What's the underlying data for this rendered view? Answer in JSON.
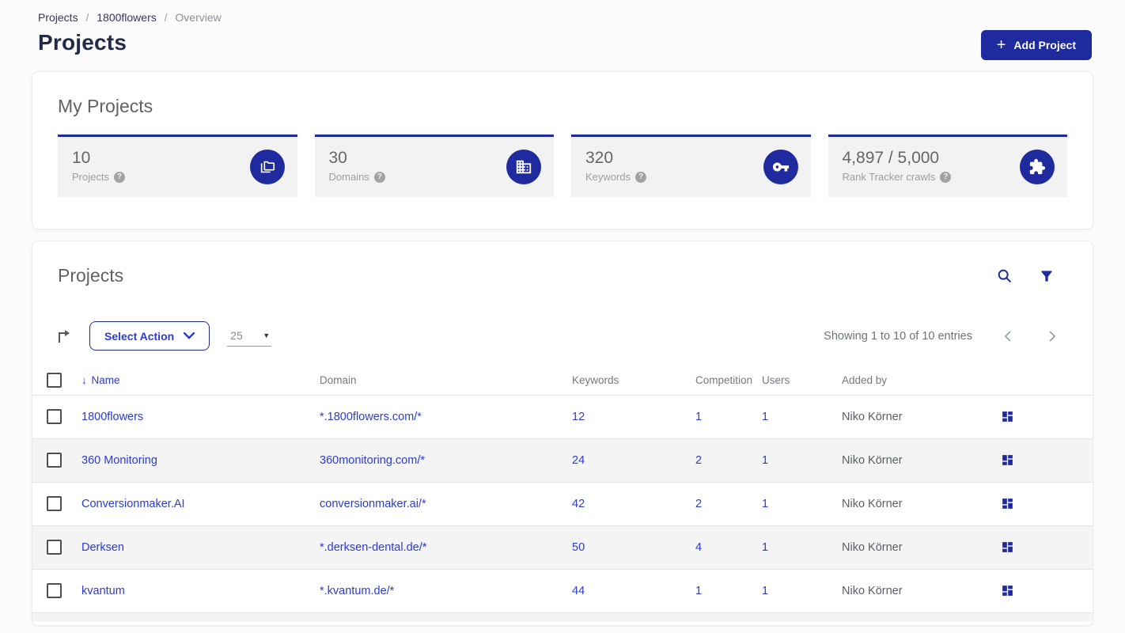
{
  "colors": {
    "brand_blue": "#1e2a9d",
    "link_blue": "#2c3bd2",
    "title_navy": "#232b46",
    "card_bg": "#f2f2f2",
    "alt_row_bg": "#f4f4f4"
  },
  "breadcrumb": {
    "separator": "/",
    "items": [
      {
        "label": "Projects"
      },
      {
        "label": "1800flowers"
      },
      {
        "label": "Overview"
      }
    ]
  },
  "header": {
    "title": "Projects",
    "add_button_label": "Add Project",
    "add_button_icon": "plus-icon"
  },
  "my_projects": {
    "title": "My Projects",
    "help_glyph": "?",
    "stats": [
      {
        "value": "10",
        "label": "Projects",
        "icon": "folders-icon"
      },
      {
        "value": "30",
        "label": "Domains",
        "icon": "buildings-icon"
      },
      {
        "value": "320",
        "label": "Keywords",
        "icon": "key-icon"
      },
      {
        "value": "4,897 / 5,000",
        "label": "Rank Tracker crawls",
        "icon": "puzzle-icon"
      }
    ]
  },
  "projects_panel": {
    "title": "Projects",
    "icons": [
      "search-icon",
      "filter-icon"
    ],
    "toolbar": {
      "export_icon": "export-arrow-icon",
      "select_action_label": "Select Action",
      "page_size_value": "25",
      "showing_text": "Showing 1 to 10 of 10 entries",
      "pager_icons": [
        "chevron-left-icon",
        "chevron-right-icon"
      ]
    },
    "table": {
      "sort": {
        "column": "Name",
        "direction": "desc",
        "arrow": "↓"
      },
      "headers": {
        "name": "Name",
        "domain": "Domain",
        "keywords": "Keywords",
        "competition": "Competition",
        "users": "Users",
        "added_by": "Added by"
      },
      "row_action_icon": "dashboard-icon",
      "rows": [
        {
          "name": "1800flowers",
          "domain": "*.1800flowers.com/*",
          "keywords": "12",
          "competition": "1",
          "users": "1",
          "added_by": "Niko Körner"
        },
        {
          "name": "360 Monitoring",
          "domain": "360monitoring.com/*",
          "keywords": "24",
          "competition": "2",
          "users": "1",
          "added_by": "Niko Körner"
        },
        {
          "name": "Conversionmaker.AI",
          "domain": "conversionmaker.ai/*",
          "keywords": "42",
          "competition": "2",
          "users": "1",
          "added_by": "Niko Körner"
        },
        {
          "name": "Derksen",
          "domain": "*.derksen-dental.de/*",
          "keywords": "50",
          "competition": "4",
          "users": "1",
          "added_by": "Niko Körner"
        },
        {
          "name": "kvantum",
          "domain": "*.kvantum.de/*",
          "keywords": "44",
          "competition": "1",
          "users": "1",
          "added_by": "Niko Körner"
        }
      ]
    }
  }
}
